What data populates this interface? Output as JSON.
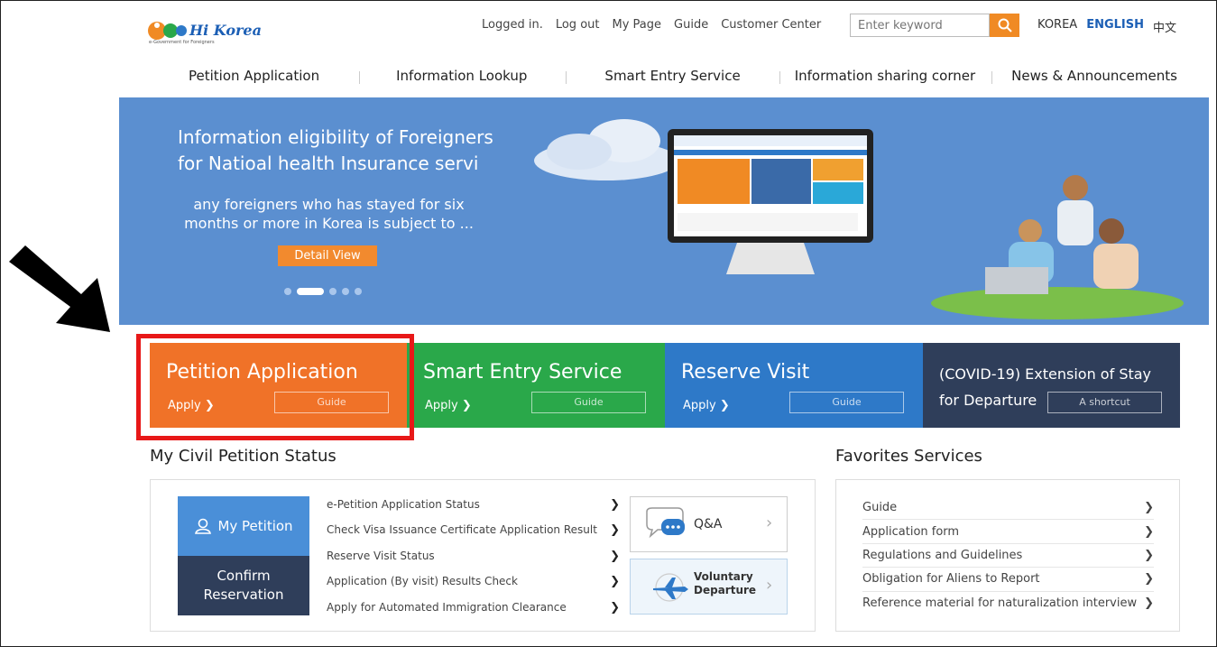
{
  "header": {
    "logo_text": "Hi Korea",
    "logo_sub": "e-Government for Foreigners",
    "util_links": [
      "Logged in.",
      "Log out",
      "My Page",
      "Guide",
      "Customer Center"
    ],
    "search_placeholder": "Enter keyword",
    "languages": [
      "KOREA",
      "ENGLISH",
      "中文"
    ],
    "active_language": "ENGLISH"
  },
  "nav": [
    "Petition Application",
    "Information Lookup",
    "Smart Entry Service",
    "Information sharing corner",
    "News & Announcements"
  ],
  "banner": {
    "title_line1": "Information eligibility of Foreigners",
    "title_line2": "for Natioal health Insurance servi",
    "sub_line1": "any foreigners who has stayed for six",
    "sub_line2": "months or more in Korea is subject to ...",
    "button": "Detail View",
    "bg_color": "#5b8fd0"
  },
  "tiles": [
    {
      "title": "Petition Application",
      "apply": "Apply",
      "guide": "Guide",
      "color": "#f07228"
    },
    {
      "title": "Smart Entry Service",
      "apply": "Apply",
      "guide": "Guide",
      "color": "#2aa84a"
    },
    {
      "title": "Reserve Visit",
      "apply": "Apply",
      "guide": "Guide",
      "color": "#2e79c8"
    },
    {
      "title_line1": "(COVID-19) Extension of Stay",
      "title_line2": "for Departure",
      "guide": "A shortcut",
      "color": "#2f3e5a"
    }
  ],
  "status": {
    "title": "My Civil Petition Status",
    "my_petition": "My Petition",
    "confirm_line1": "Confirm",
    "confirm_line2": "Reservation",
    "items": [
      "e-Petition Application Status",
      "Check Visa Issuance Certificate Application Result",
      "Reserve Visit Status",
      "Application (By visit) Results Check",
      "Apply for Automated Immigration Clearance"
    ],
    "qa": "Q&A",
    "voluntary_line1": "Voluntary",
    "voluntary_line2": "Departure"
  },
  "favorites": {
    "title": "Favorites Services",
    "items": [
      "Guide",
      "Application form",
      "Regulations and Guidelines",
      "Obligation for Aliens to Report",
      "Reference material for naturalization interview"
    ]
  }
}
